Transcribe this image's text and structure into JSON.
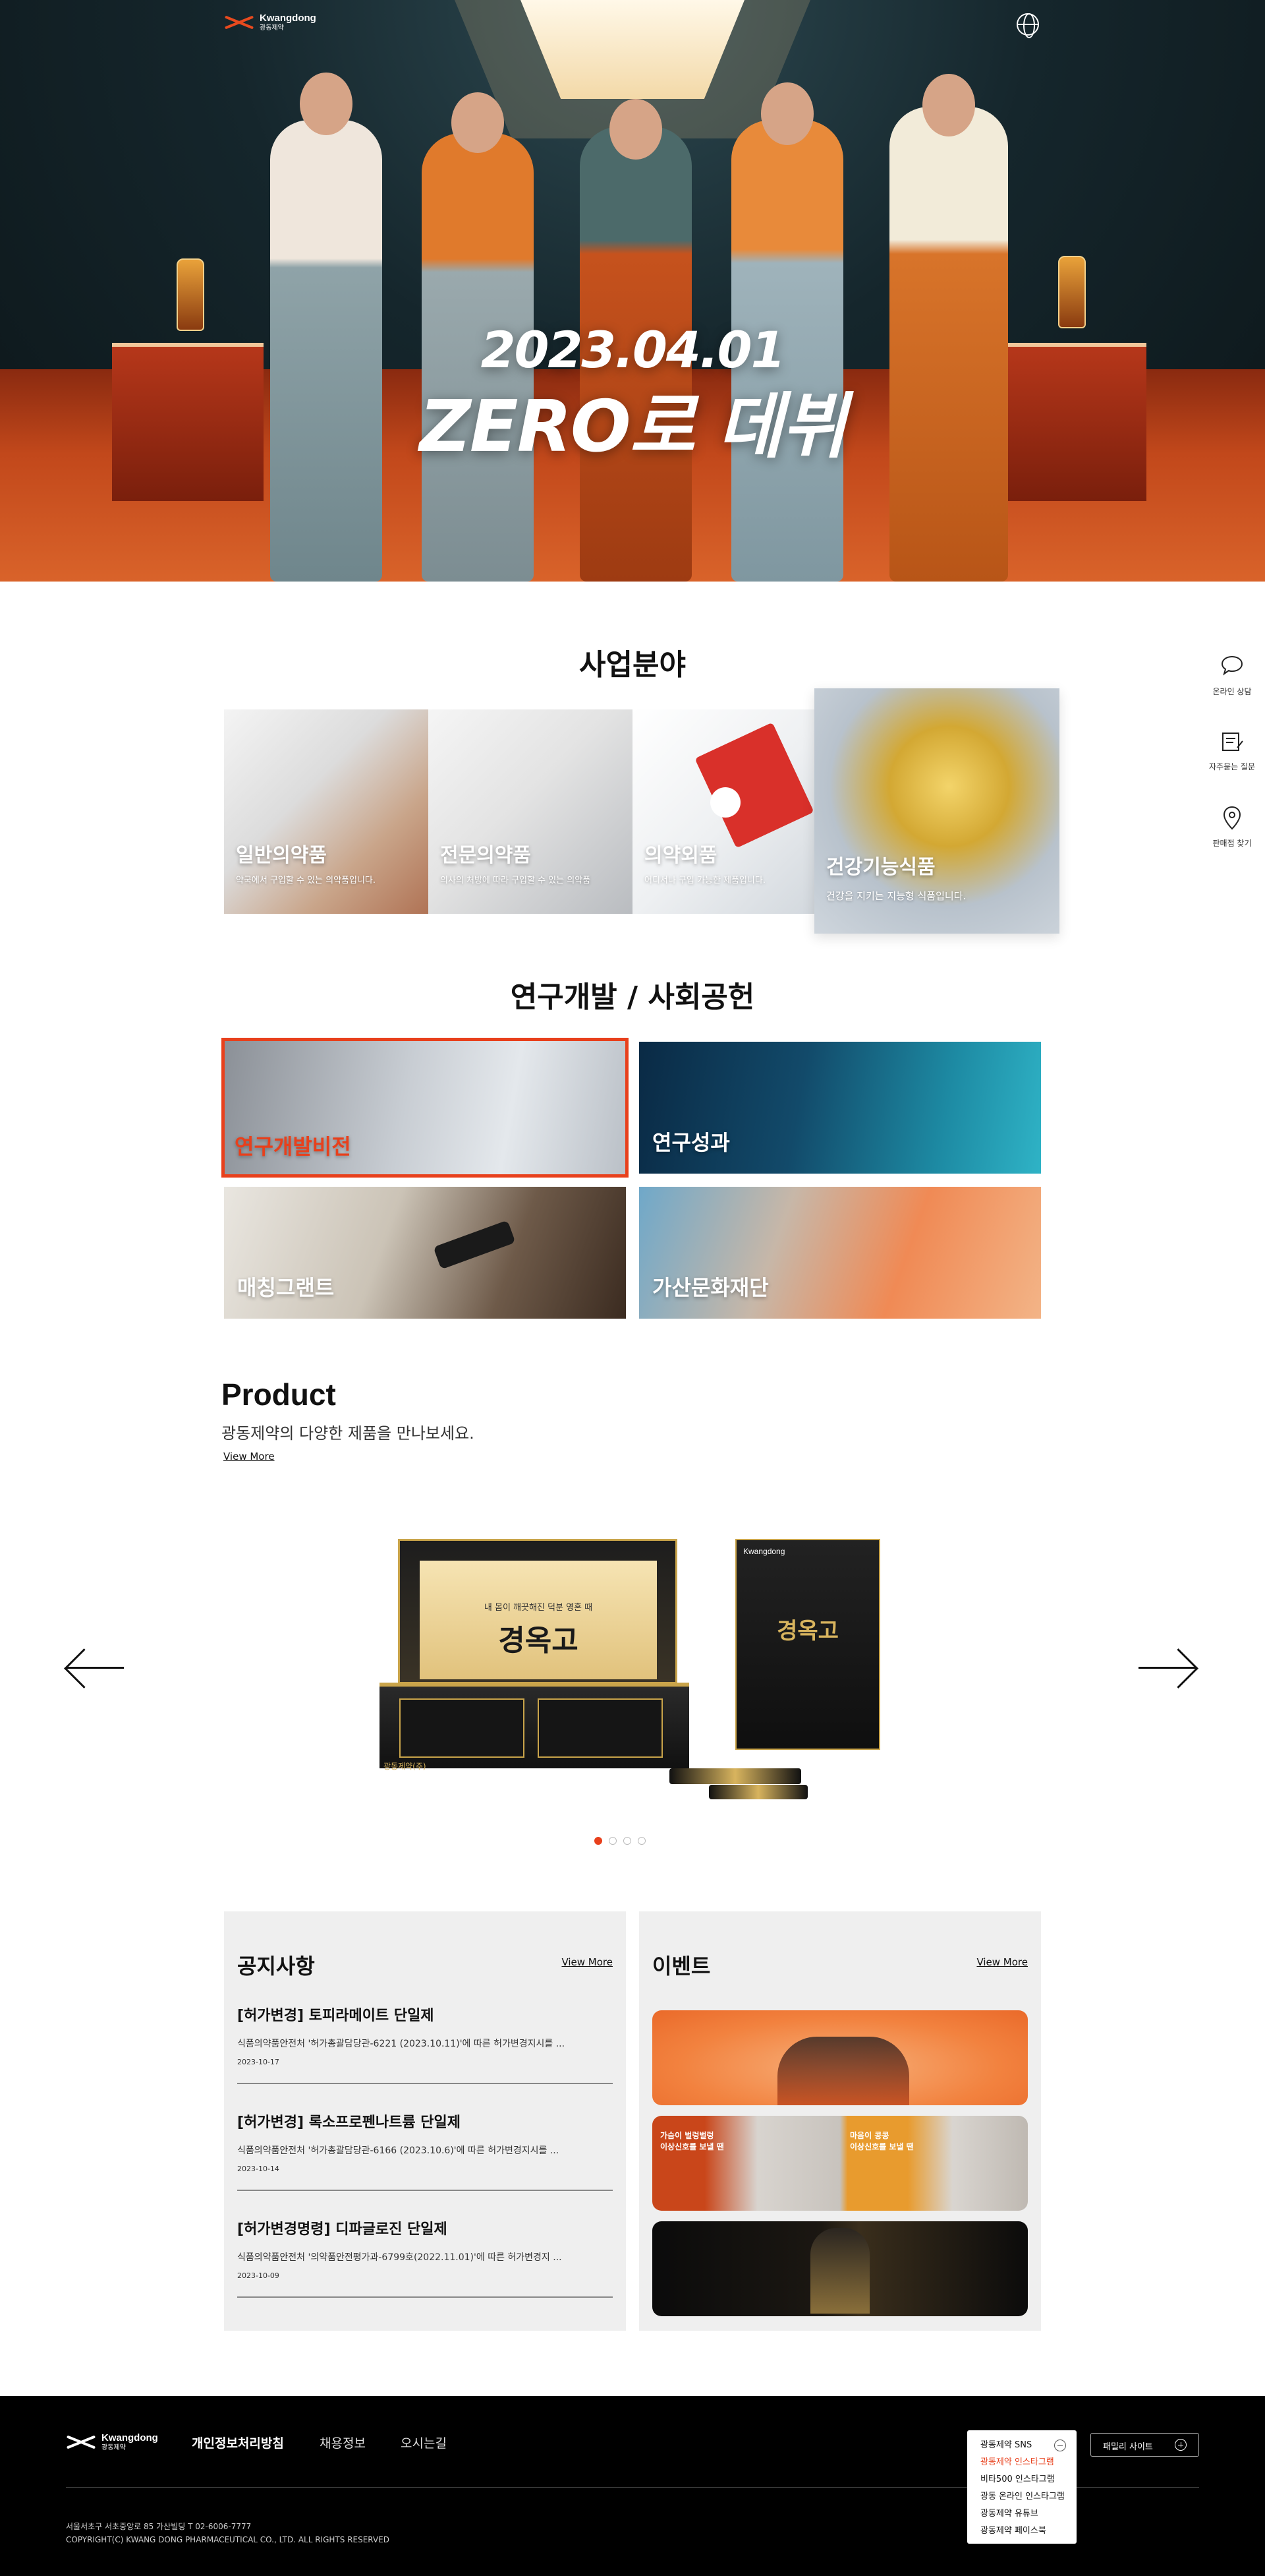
{
  "header": {
    "logo_en": "Kwangdong",
    "logo_ko": "광동제약",
    "language_icon": "globe-icon"
  },
  "hero": {
    "date": "2023.04.01",
    "headline": "ZERO로 데뷔"
  },
  "business": {
    "title": "사업분야",
    "tiles": [
      {
        "title": "일반의약품",
        "desc": "약국에서 구입할 수 있는 의약품입니다."
      },
      {
        "title": "전문의약품",
        "desc": "의사의 처방에 따라 구입할 수 있는 의약품"
      },
      {
        "title": "의약외품",
        "desc": "어디서나 구입 가능한 제품입니다."
      },
      {
        "title": "건강기능식품",
        "desc": "건강을 지키는 지능형 식품입니다."
      }
    ]
  },
  "rd": {
    "title": "연구개발 / 사회공헌",
    "tiles": [
      {
        "title": "연구개발비전"
      },
      {
        "title": "연구성과"
      },
      {
        "title": "매칭그랜트"
      },
      {
        "title": "가산문화재단"
      }
    ]
  },
  "quick_menu": [
    {
      "label": "온라인 상담",
      "icon": "chat-bubble-icon"
    },
    {
      "label": "자주묻는 질문",
      "icon": "faq-note-icon"
    },
    {
      "label": "판매점 찾기",
      "icon": "location-pin-icon"
    }
  ],
  "product": {
    "title": "Product",
    "subtitle": "광동제약의 다양한 제품을 만나보세요.",
    "view_more": "View More",
    "current_product_name": "경옥고",
    "box_caption": "내 몸이 깨끗해진 덕분 영혼 때",
    "brand_mark": "광동",
    "maker": "광동제약(주)",
    "slides_total": 4,
    "active_slide": 1
  },
  "notice": {
    "title": "공지사항",
    "view_more": "View More",
    "items": [
      {
        "title": "[허가변경] 토피라메이트 단일제",
        "body": "식품의약품안전처 '허가총괄담당관-6221 (2023.10.11)'에 따른 허가변경지시를 ...",
        "date": "2023-10-17"
      },
      {
        "title": "[허가변경] 록소프로펜나트륨 단일제",
        "body": "식품의약품안전처 '허가총괄담당관-6166 (2023.10.6)'에 따른 허가변경지시를 ...",
        "date": "2023-10-14"
      },
      {
        "title": "[허가변경명령] 디파글로진 단일제",
        "body": "식품의약품안전처 '의약품안전평가과-6799호(2022.11.01)'에 따른 허가변경지 ...",
        "date": "2023-10-09"
      }
    ]
  },
  "event": {
    "title": "이벤트",
    "view_more": "View More",
    "banner2_left": "가슴이 벌렁벌렁\n이상신호를 보낼 땐",
    "banner2_right": "마음이 콩콩\n이상신호를 보낼 땐"
  },
  "footer": {
    "logo_en": "Kwangdong",
    "logo_ko": "광동제약",
    "nav": [
      "개인정보처리방침",
      "채용정보",
      "오시는길"
    ],
    "family_site": "패밀리 사이트",
    "sns_title": "광동제약 SNS",
    "sns_items": [
      "광동제약 인스타그램",
      "비타500 인스타그램",
      "광동 온라인 인스타그램",
      "광동제약 유튜브",
      "광동제약 페이스북"
    ],
    "address": "서울서초구 서초중앙로 85 가산빌딩 T 02-6006-7777",
    "copyright": "COPYRIGHT(C) KWANG DONG PHARMACEUTICAL CO., LTD. ALL RIGHTS RESERVED"
  },
  "colors": {
    "accent": "#e8401c",
    "footer_bg": "#000000",
    "card_bg": "#efefef"
  }
}
